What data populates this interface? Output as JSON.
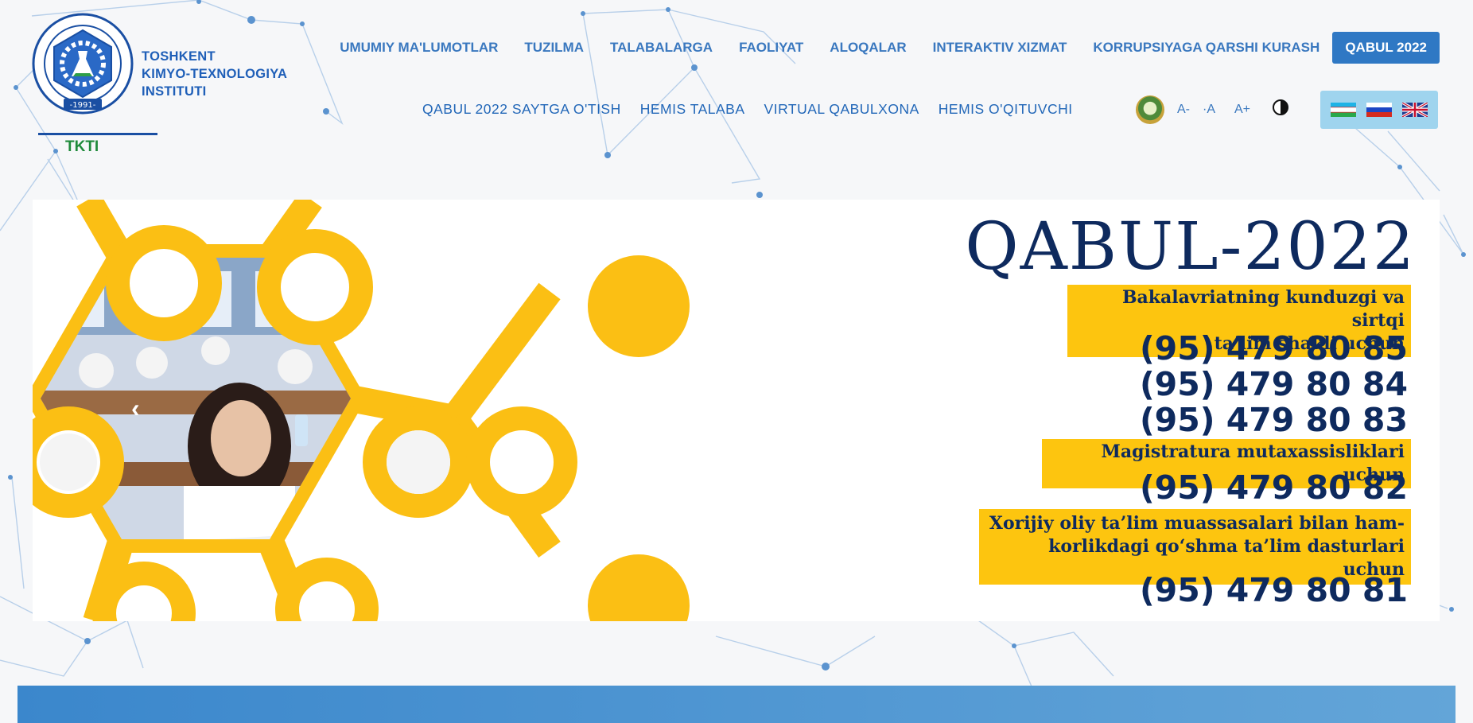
{
  "header": {
    "logo": {
      "name_lines": [
        "TOSHKENT",
        "KIMYO-TEXNOLOGIYA",
        "INSTITUTI"
      ],
      "abbr": "TKTI",
      "seal_text": "TOSHKENT KIMYO - TEXNOLOGIYA INSTITUTI",
      "seal_year": "-1991-"
    },
    "nav_primary": [
      "UMUMIY MA'LUMOTLAR",
      "TUZILMA",
      "TALABALARGA",
      "FAOLIYAT",
      "ALOQALAR",
      "INTERAKTIV XIZMAT",
      "KORRUPSIYAGA QARSHI KURASH"
    ],
    "admission_button": "QABUL 2022",
    "nav_secondary": [
      "QABUL 2022 SAYTGA O'TISH",
      "HEMIS TALABA",
      "VIRTUAL QABULXONA",
      "HEMIS O'QITUVCHI"
    ],
    "accessibility": {
      "emblem_icon": "state-emblem-icon",
      "font_decrease": "A-",
      "font_reset": "·A",
      "font_increase": "A+",
      "contrast_icon": "contrast-icon"
    },
    "languages": [
      {
        "code": "uz",
        "icon": "flag-uzbekistan-icon"
      },
      {
        "code": "ru",
        "icon": "flag-russia-icon"
      },
      {
        "code": "en",
        "icon": "flag-uk-icon"
      }
    ]
  },
  "hero": {
    "title": "QABUL-2022",
    "bachelor_label_line1": "Bakalavriatning kunduzgi va sirtqi",
    "bachelor_label_line2": "ta’lim shakli uchun",
    "bachelor_phones": [
      "(95) 479 80 85",
      "(95) 479 80 84",
      "(95) 479 80 83"
    ],
    "master_label": "Magistratura mutaxassisliklari uchun",
    "master_phone": "(95) 479 80 82",
    "joint_label_line1": "Xorijiy oliy ta’lim muassasalari bilan ham-",
    "joint_label_line2": "korlikdagi qo‘shma ta’lim dasturlari uchun",
    "joint_phone": "(95) 479 80 81",
    "prev_arrow": "‹"
  },
  "colors": {
    "brand_blue": "#2f78c4",
    "navy": "#0e2a5e",
    "accent_yellow": "#fdc50f",
    "logo_green": "#1e8a3a"
  }
}
